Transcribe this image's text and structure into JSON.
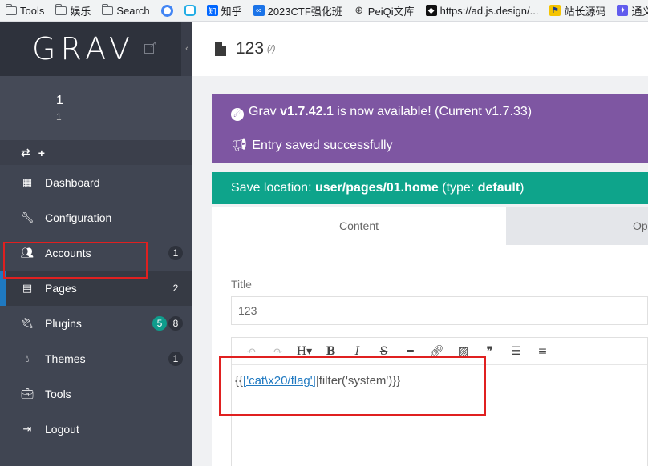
{
  "bookmarks": [
    {
      "label": "Tools",
      "icon": "folder-icon"
    },
    {
      "label": "娱乐",
      "icon": "folder-icon"
    },
    {
      "label": "Search",
      "icon": "folder-icon"
    },
    {
      "label": "",
      "icon": "google-icon"
    },
    {
      "label": "",
      "icon": "bilibili-icon"
    },
    {
      "label": "知乎",
      "icon": "zhihu-icon"
    },
    {
      "label": "2023CTF强化班",
      "icon": "link-icon"
    },
    {
      "label": "PeiQi文库",
      "icon": "globe-icon"
    },
    {
      "label": "https://ad.js.design/...",
      "icon": "jsdesign-icon"
    },
    {
      "label": "站长源码",
      "icon": "flag-icon"
    },
    {
      "label": "通义千",
      "icon": "tongyi-icon"
    }
  ],
  "sidebar": {
    "logo": "GRAV",
    "collapse": "‹",
    "user": {
      "name": "1",
      "sub": "1"
    },
    "quick": {
      "sync": "⇄",
      "add": "+"
    },
    "items": [
      {
        "label": "Dashboard",
        "icon": "grid-icon",
        "badge": ""
      },
      {
        "label": "Configuration",
        "icon": "wrench-icon",
        "badge": ""
      },
      {
        "label": "Accounts",
        "icon": "users-icon",
        "badge": "1"
      },
      {
        "label": "Pages",
        "icon": "file-icon",
        "badge": "2"
      },
      {
        "label": "Plugins",
        "icon": "plug-icon",
        "badge": "8",
        "badge_green": "5"
      },
      {
        "label": "Themes",
        "icon": "drop-icon",
        "badge": "1"
      },
      {
        "label": "Tools",
        "icon": "briefcase-icon",
        "badge": ""
      },
      {
        "label": "Logout",
        "icon": "signout-icon",
        "badge": ""
      }
    ]
  },
  "header": {
    "title": "123",
    "route": "(/)"
  },
  "notice": {
    "update_prefix": "Grav ",
    "update_version": "v1.7.42.1",
    "update_suffix": " is now available! (Current v1.7.33)",
    "saved": "Entry saved successfully"
  },
  "location": {
    "prefix": "Save location: ",
    "path": "user/pages/01.home",
    "type_prefix": " (type: ",
    "type": "default",
    "type_suffix": ")"
  },
  "tabs": {
    "content": "Content",
    "options": "Op"
  },
  "form": {
    "title_label": "Title",
    "title_value": "123",
    "code_open": "{{",
    "code_link": "['cat\\x20/flag']",
    "code_rest": "|filter('system')}}"
  },
  "colors": {
    "sidebar": "#404552",
    "notice": "#7e56a2",
    "location": "#0ea48b",
    "active_bar": "#1f79c1",
    "highlight": "#e02020"
  }
}
